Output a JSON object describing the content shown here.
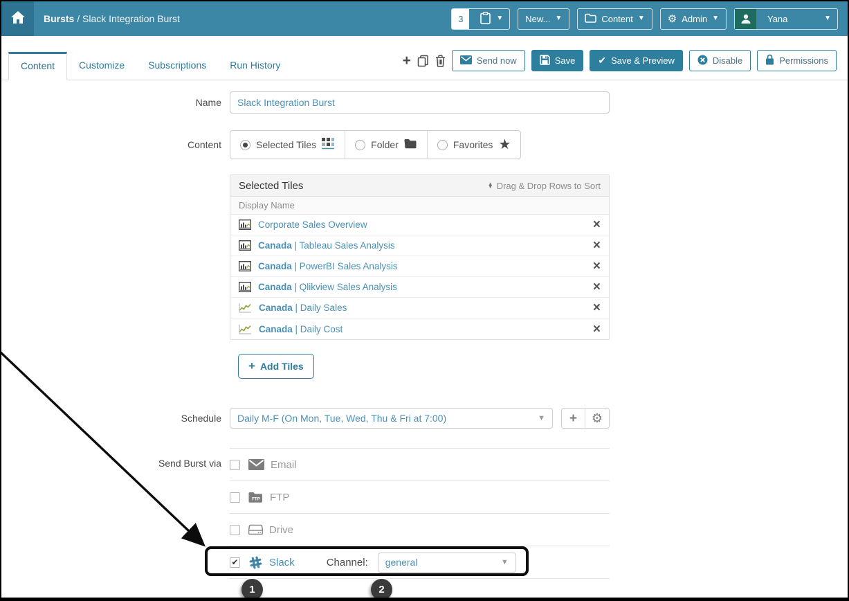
{
  "colors": {
    "accent": "#3d87a6",
    "accent_dark": "#2e7e9e",
    "link": "#4a90b5",
    "home_bg": "#2e7492",
    "avatar_bg": "#206b60",
    "annotation": "#0c0c0c"
  },
  "header": {
    "breadcrumb_bold": "Bursts",
    "breadcrumb_sep": " / ",
    "breadcrumb_current": "Slack Integration Burst",
    "clipboard_count": "3",
    "new_button": "New...",
    "content_button": "Content",
    "admin_button": "Admin",
    "user_name": "Yana"
  },
  "tabs": {
    "items": [
      "Content",
      "Customize",
      "Subscriptions",
      "Run History"
    ],
    "active": "Content"
  },
  "toolbar": {
    "send_now": "Send now",
    "save": "Save",
    "save_preview": "Save & Preview",
    "disable": "Disable",
    "permissions": "Permissions"
  },
  "form": {
    "name_label": "Name",
    "name_value": "Slack Integration Burst",
    "content_label": "Content",
    "content_options": [
      {
        "label": "Selected Tiles",
        "selected": true,
        "icon": "tiles-grid"
      },
      {
        "label": "Folder",
        "selected": false,
        "icon": "folder"
      },
      {
        "label": "Favorites",
        "selected": false,
        "icon": "star"
      }
    ]
  },
  "tiles_panel": {
    "title": "Selected Tiles",
    "sort_hint": "Drag & Drop Rows to Sort",
    "column_header": "Display Name",
    "rows": [
      {
        "prefix": "",
        "separator": "",
        "name": "Corporate Sales Overview",
        "icon": "bar-chart"
      },
      {
        "prefix": "Canada",
        "separator": " | ",
        "name": "Tableau Sales Analysis",
        "icon": "bar-chart"
      },
      {
        "prefix": "Canada",
        "separator": " | ",
        "name": "PowerBI Sales Analysis",
        "icon": "bar-chart"
      },
      {
        "prefix": "Canada",
        "separator": " | ",
        "name": "Qlikview Sales Analysis",
        "icon": "bar-chart"
      },
      {
        "prefix": "Canada",
        "separator": " | ",
        "name": "Daily Sales",
        "icon": "line-chart"
      },
      {
        "prefix": "Canada",
        "separator": " | ",
        "name": "Daily Cost",
        "icon": "line-chart"
      }
    ]
  },
  "add_tiles": {
    "label": "Add Tiles"
  },
  "schedule": {
    "label": "Schedule",
    "value": "Daily M-F (On Mon, Tue, Wed, Thu & Fri at 7:00)"
  },
  "send_via": {
    "label": "Send Burst via",
    "options": [
      {
        "label": "Email",
        "checked": false,
        "icon": "envelope"
      },
      {
        "label": "FTP",
        "checked": false,
        "icon": "ftp-folder"
      },
      {
        "label": "Drive",
        "checked": false,
        "icon": "hard-drive"
      },
      {
        "label": "Slack",
        "checked": true,
        "icon": "slack-hash"
      }
    ]
  },
  "slack": {
    "channel_label": "Channel:",
    "channel_value": "general"
  },
  "annotations": {
    "badge_1": "1",
    "badge_2": "2"
  },
  "icons": {
    "home": "house",
    "clipboard": "clipboard",
    "caret": "triangle-down",
    "folder": "folder",
    "gear": "gear",
    "user": "person-silhouette",
    "plus": "plus",
    "copy": "duplicate-pages",
    "trash": "trash-can",
    "envelope": "envelope",
    "floppy": "save-disk",
    "check": "checkmark",
    "disable": "circle-x",
    "lock": "padlock",
    "sort": "up-down-triangles",
    "remove": "x-cross",
    "tiles_grid": "square-grid",
    "star": "star",
    "bar_chart": "framed-bar-chart",
    "line_chart": "line-chart",
    "slack": "slack-hash",
    "drive": "hard-drive"
  }
}
